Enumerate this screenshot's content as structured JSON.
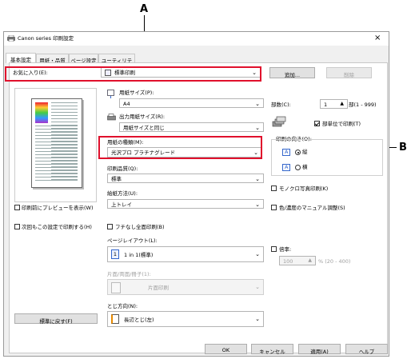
{
  "callouts": {
    "a": "A",
    "b": "B"
  },
  "window": {
    "title": "Canon series 印刷設定",
    "close_glyph": "×"
  },
  "tabs": [
    "基本設定",
    "用紙・品質",
    "ページ設定",
    "ユーティリティ"
  ],
  "favorites": {
    "label": "お気に入り(E):",
    "value": "標準印刷",
    "add_button": "追加...",
    "delete_button": "削除"
  },
  "paper_size": {
    "label": "用紙サイズ(P):",
    "value": "A4"
  },
  "output_size": {
    "label": "出力用紙サイズ(R):",
    "value": "用紙サイズと同じ"
  },
  "media_type": {
    "label": "用紙の種類(M):",
    "value": "光沢プロ プラチナグレード"
  },
  "quality": {
    "label": "印刷品質(Q):",
    "value": "標準"
  },
  "paper_source": {
    "label": "給紙方法(U):",
    "value": "上トレイ"
  },
  "copies": {
    "label": "部数(C):",
    "value": "1",
    "range": "部(1 - 999)",
    "collate_label": "部単位で印刷(T)",
    "collate_checked": true
  },
  "orientation": {
    "label": "印刷の向き(O):",
    "portrait": "縦",
    "landscape": "横",
    "selected": "portrait",
    "glyph": "A"
  },
  "left_options": {
    "preview_label": "印刷前にプレビューを表示(W)",
    "preview_checked": false,
    "same_settings_label": "次回もこの設定で印刷する(H)",
    "same_settings_checked": false,
    "defaults_button": "標準に戻す(F)"
  },
  "mono_photo": {
    "label": "モノクロ写真印刷(K)",
    "checked": false
  },
  "color_adjust": {
    "label": "色/濃度のマニュアル調整(S)",
    "checked": false
  },
  "borderless": {
    "label": "フチなし全面印刷(B)",
    "checked": false
  },
  "page_layout": {
    "label": "ページレイアウト(L):",
    "value": "1 in 1(標準)",
    "icon_text": "1"
  },
  "scaling": {
    "label": "倍率:",
    "value": "100",
    "range": "% (20 - 400)",
    "checked": false
  },
  "duplex": {
    "label": "片面/両面/冊子(1):",
    "value": "片面印刷"
  },
  "binding": {
    "label": "とじ方向(N):",
    "value": "長辺とじ(左)"
  },
  "footer": {
    "ok": "OK",
    "cancel": "キャンセル",
    "apply": "適用(A)",
    "help": "ヘルプ"
  },
  "colors": {
    "callout_red": "#e0102c",
    "arrow_blue": "#3366cc"
  },
  "icons": {
    "printer": "printer-icon",
    "paper": "paper-icon",
    "dropdown": "chevron-down-icon"
  }
}
